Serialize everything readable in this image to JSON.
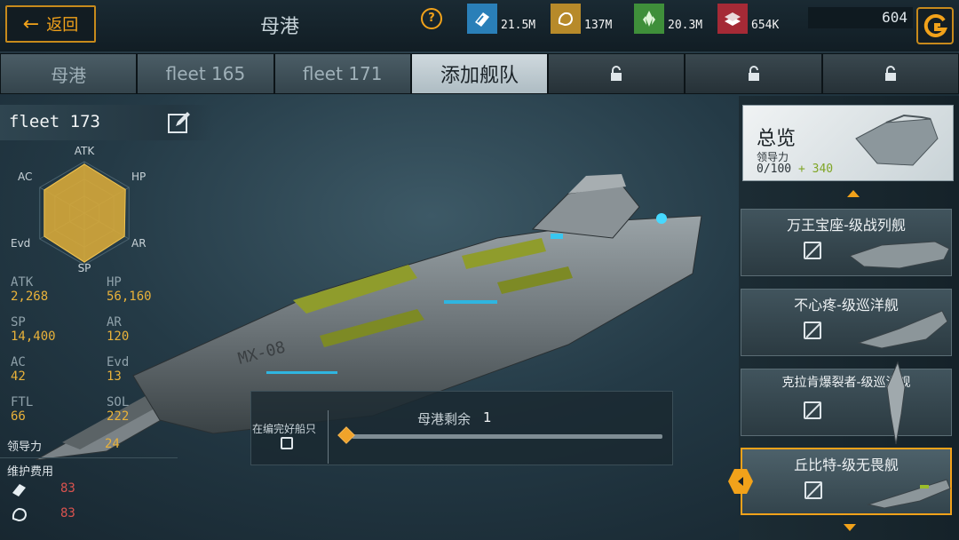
{
  "header": {
    "back_label": "返回",
    "title": "母港",
    "help_icon": "help-icon",
    "resources": [
      {
        "icon": "crystal-pack-icon",
        "value": "21.5M",
        "color": "#2a7fb8"
      },
      {
        "icon": "ore-rock-icon",
        "value": "137M",
        "color": "#b78a2a"
      },
      {
        "icon": "green-crystal-icon",
        "value": "20.3M",
        "color": "#3f8f3a"
      },
      {
        "icon": "metal-ingot-icon",
        "value": "654K",
        "color": "#a52a36"
      }
    ],
    "credits": "604",
    "credits_icon": "g-coin-icon"
  },
  "tabs": [
    {
      "label": "母港",
      "state": "normal"
    },
    {
      "label": "fleet 165",
      "state": "normal"
    },
    {
      "label": "fleet 171",
      "state": "normal"
    },
    {
      "label": "添加舰队",
      "state": "active"
    },
    {
      "label": "",
      "state": "locked",
      "icon": "lock-icon"
    },
    {
      "label": "",
      "state": "locked",
      "icon": "lock-icon"
    },
    {
      "label": "",
      "state": "locked",
      "icon": "lock-icon"
    }
  ],
  "fleet": {
    "name": "fleet 173",
    "radar_labels": {
      "atk": "ATK",
      "hp": "HP",
      "ar": "AR",
      "sp": "SP",
      "evd": "Evd",
      "ac": "AC"
    },
    "radar_values": {
      "atk": 0.95,
      "hp": 0.92,
      "ar": 0.9,
      "sp": 0.95,
      "evd": 0.9,
      "ac": 0.9
    },
    "stats": [
      {
        "l1": "ATK",
        "v1": "2,268",
        "l2": "HP",
        "v2": "56,160"
      },
      {
        "l1": "SP",
        "v1": "14,400",
        "l2": "AR",
        "v2": "120"
      },
      {
        "l1": "AC",
        "v1": "42",
        "l2": "Evd",
        "v2": "13"
      },
      {
        "l1": "FTL",
        "v1": "66",
        "l2": "SOL",
        "v2": "222"
      }
    ],
    "leadership_label": "领导力",
    "leadership_value": "24",
    "upkeep_label": "维护费用",
    "upkeep": [
      {
        "icon": "crystal-pack-icon",
        "value": "83"
      },
      {
        "icon": "ore-rock-icon",
        "value": "83"
      }
    ]
  },
  "ship": {
    "hull_marking": "MX-08"
  },
  "hangar": {
    "remaining_label": "母港剩余",
    "remaining_value": "1",
    "ready_label": "在编完好船只",
    "slider_fraction": 0.0
  },
  "overview": {
    "title": "总览",
    "sub_label": "领导力",
    "value": "0/100",
    "bonus": "+ 340"
  },
  "ship_list": [
    {
      "name": "万王宝座-级战列舰",
      "selected": false
    },
    {
      "name": "不心疼-级巡洋舰",
      "selected": false
    },
    {
      "name": "克拉肯爆裂者-级巡洋舰",
      "selected": false
    },
    {
      "name": "丘比特-级无畏舰",
      "selected": true
    }
  ]
}
